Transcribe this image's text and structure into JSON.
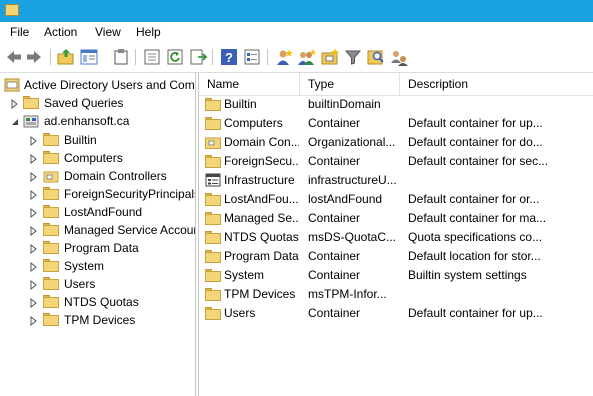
{
  "menu": [
    "File",
    "Action",
    "View",
    "Help"
  ],
  "toolbar": {
    "icons": [
      "back-arrow-icon",
      "forward-arrow-icon",
      "up-folder-icon",
      "show-console-tree-icon",
      "clipboard-icon",
      "export-list-icon",
      "refresh-icon",
      "export-icon",
      "help-icon",
      "properties-icon",
      "new-user-icon",
      "new-group-icon",
      "new-ou-icon",
      "filter-icon",
      "find-icon",
      "add-to-group-icon"
    ]
  },
  "tree": {
    "root": "Active Directory Users and Com",
    "saved_queries": "Saved Queries",
    "domain": "ad.enhansoft.ca",
    "children": [
      "Builtin",
      "Computers",
      "Domain Controllers",
      "ForeignSecurityPrincipals",
      "LostAndFound",
      "Managed Service Accounts",
      "Program Data",
      "System",
      "Users",
      "NTDS Quotas",
      "TPM Devices"
    ]
  },
  "list": {
    "columns": [
      "Name",
      "Type",
      "Description"
    ],
    "rows": [
      {
        "name": "Builtin",
        "type": "builtinDomain",
        "description": "",
        "icon": "folder-icon"
      },
      {
        "name": "Computers",
        "type": "Container",
        "description": "Default container for up...",
        "icon": "folder-icon"
      },
      {
        "name": "Domain Con...",
        "type": "Organizational...",
        "description": "Default container for do...",
        "icon": "ou-folder-icon"
      },
      {
        "name": "ForeignSecu...",
        "type": "Container",
        "description": "Default container for sec...",
        "icon": "folder-icon"
      },
      {
        "name": "Infrastructure",
        "type": "infrastructureU...",
        "description": "",
        "icon": "infrastructure-icon"
      },
      {
        "name": "LostAndFou...",
        "type": "lostAndFound",
        "description": "Default container for or...",
        "icon": "folder-icon"
      },
      {
        "name": "Managed Se...",
        "type": "Container",
        "description": "Default container for ma...",
        "icon": "folder-icon"
      },
      {
        "name": "NTDS Quotas",
        "type": "msDS-QuotaC...",
        "description": "Quota specifications co...",
        "icon": "folder-icon"
      },
      {
        "name": "Program Data",
        "type": "Container",
        "description": "Default location for stor...",
        "icon": "folder-icon"
      },
      {
        "name": "System",
        "type": "Container",
        "description": "Builtin system settings",
        "icon": "folder-icon"
      },
      {
        "name": "TPM Devices",
        "type": "msTPM-Infor...",
        "description": "",
        "icon": "folder-icon"
      },
      {
        "name": "Users",
        "type": "Container",
        "description": "Default container for up...",
        "icon": "folder-icon"
      }
    ]
  },
  "colors": {
    "titlebar": "#1aa1e2",
    "folder": "#f5d57a"
  }
}
